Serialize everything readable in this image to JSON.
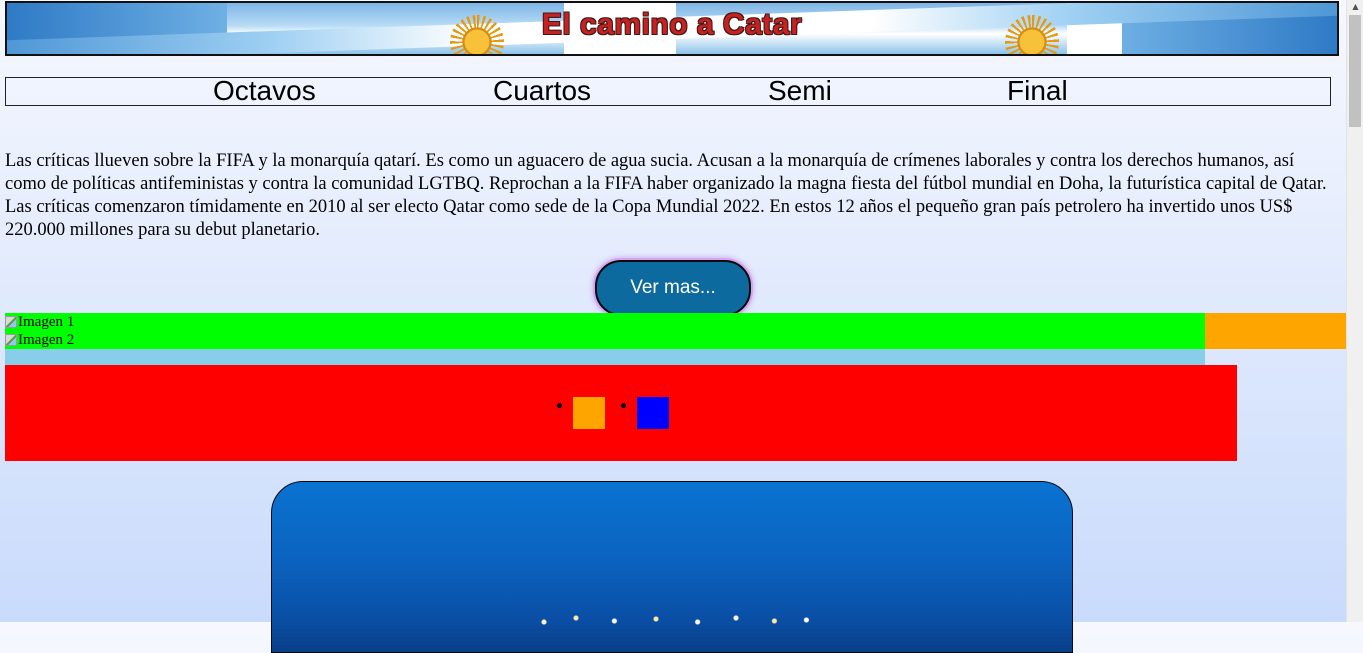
{
  "banner": {
    "title": "El camino a Catar"
  },
  "nav": {
    "items": [
      "Octavos",
      "Cuartos",
      "Semi",
      "Final"
    ]
  },
  "article": {
    "paragraph": "Las críticas llueven sobre la FIFA y la monarquía qatarí. Es como un aguacero de agua sucia. Acusan a la monarquía de crímenes laborales y contra los derechos humanos, así como de políticas antifeministas y contra la comunidad LGTBQ. Reprochan a la FIFA haber organizado la magna fiesta del fútbol mundial en Doha, la futurística capital de Qatar. Las críticas comenzaron tímidamente en 2010 al ser electo Qatar como sede de la Copa Mundial 2022. En estos 12 años el pequeño gran país petrolero ha invertido unos US$ 220.000 millones para su debut planetario.",
    "button_label": "Ver mas..."
  },
  "slider": {
    "image1_alt": "Imagen 1",
    "image2_alt": "Imagen 2"
  },
  "colors": {
    "green": "#00ff00",
    "orange": "#ffa500",
    "light_blue": "#87ceeb",
    "red": "#ff0000",
    "blue": "#0000ff",
    "button": "#0d6a9f"
  },
  "icons": {
    "sun": "sun-of-may-icon",
    "broken_image": "broken-image-icon"
  }
}
